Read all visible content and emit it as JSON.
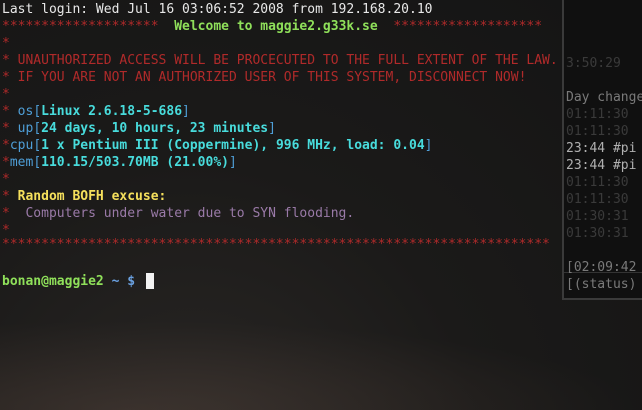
{
  "terminal": {
    "last_login": "Last login: Wed Jul 16 03:06:52 2008 from 192.168.20.10",
    "banner_left": "********************",
    "banner_title": "Welcome to maggie2.g33k.se",
    "banner_right": "*******************",
    "star": "*",
    "warning1": "UNAUTHORIZED ACCESS WILL BE PROCECUTED TO THE FULL EXTENT OF THE LAW.",
    "warning2": "IF YOU ARE NOT AN AUTHORIZED USER OF THIS SYSTEM, DISCONNECT NOW!",
    "info": [
      {
        "label": " os",
        "value": "Linux 2.6.18-5-686"
      },
      {
        "label": " up",
        "value": "24 days, 10 hours, 23 minutes"
      },
      {
        "label": "cpu",
        "value": "1 x Pentium III (Coppermine), 996 MHz, load: 0.04"
      },
      {
        "label": "mem",
        "value": "110.15/503.70MB (21.00%)"
      }
    ],
    "bofh_heading": "Random BOFH excuse:",
    "bofh_text": "Computers under water due to SYN flooding.",
    "rule": "**********************************************************************",
    "prompt_user": "bonan@maggie2",
    "prompt_dir": "~",
    "prompt_symbol": "$"
  },
  "background_window": {
    "lines": [
      "3:50:29",
      "",
      "Day change",
      "01:11:30",
      "01:11:30",
      "23:44 #pi",
      "23:44 #pi",
      "01:11:30",
      "01:11:30",
      "01:30:31",
      "01:30:31"
    ],
    "clock": "[02:09:42",
    "status": "[(status)"
  }
}
